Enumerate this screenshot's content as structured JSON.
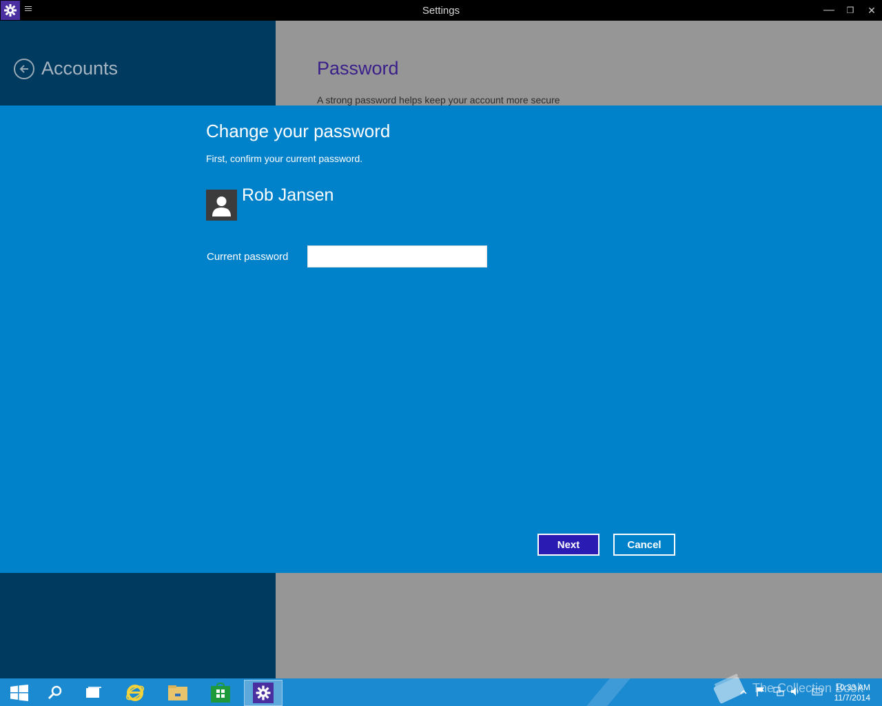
{
  "window": {
    "title": "Settings",
    "minimize_glyph": "—",
    "restore_glyph": "❐",
    "close_glyph": "✕"
  },
  "background": {
    "back_label": "Accounts",
    "section_title": "Password",
    "section_description": "A strong password helps keep your account more secure"
  },
  "dialog": {
    "title": "Change your password",
    "subtitle": "First, confirm your current password.",
    "user_name": "Rob Jansen",
    "field_label": "Current password",
    "field_value": "",
    "next_label": "Next",
    "cancel_label": "Cancel"
  },
  "taskbar": {
    "items": [
      "start-icon",
      "search-icon",
      "task-view-icon",
      "internet-explorer-icon",
      "file-explorer-icon",
      "store-icon",
      "settings-icon"
    ],
    "watermark": "The Collection Book",
    "time": "10:33 AM",
    "date": "11/7/2014"
  },
  "colors": {
    "accent": "#0082cb",
    "next_button": "#2a1bb3",
    "left_pane": "#003a5f",
    "right_pane": "#969696"
  }
}
